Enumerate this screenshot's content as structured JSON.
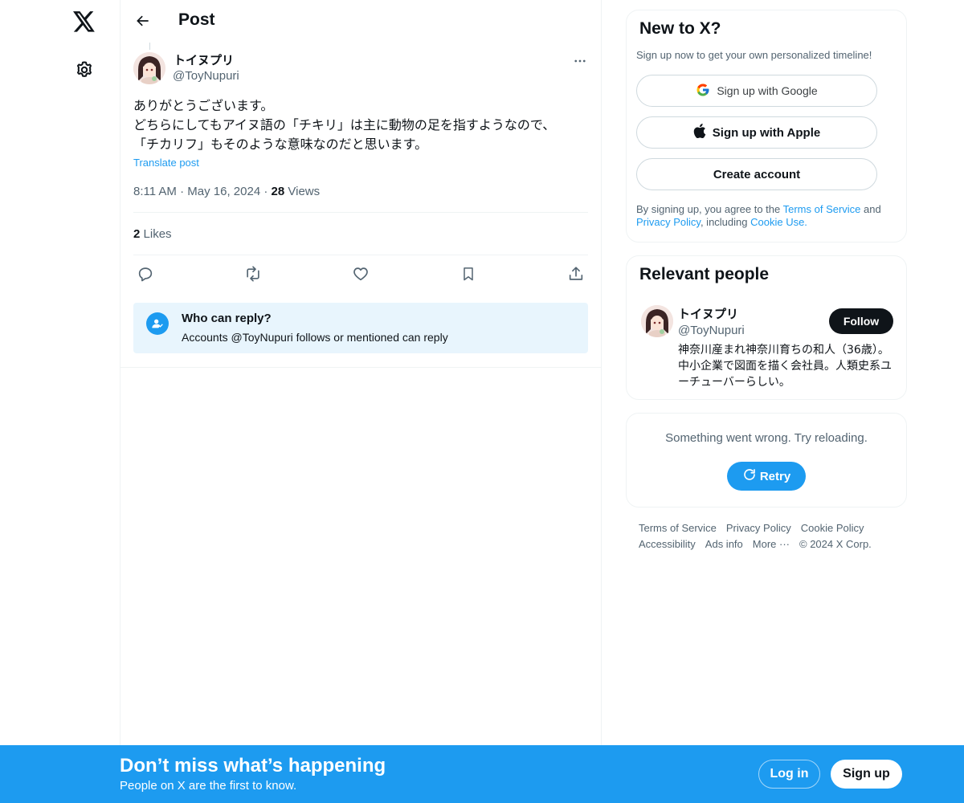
{
  "nav": {
    "logo_icon": "x-logo-icon",
    "settings_icon": "gear-icon"
  },
  "header": {
    "title": "Post"
  },
  "post": {
    "author_name": "トイヌプリ",
    "author_handle": "@ToyNupuri",
    "body_lines": [
      "ありがとうございます。",
      "どちらにしてもアイヌ語の「チキリ」は主に動物の足を指すようなので、",
      "「チカリフ」もそのような意味なのだと思います。"
    ],
    "translate_label": "Translate post",
    "time": "8:11 AM",
    "date": "May 16, 2024",
    "views_count": "28",
    "views_label": "Views",
    "likes_count": "2",
    "likes_label": "Likes"
  },
  "who_can_reply": {
    "title": "Who can reply?",
    "description": "Accounts @ToyNupuri follows or mentioned can reply"
  },
  "signup_card": {
    "title": "New to X?",
    "subtitle": "Sign up now to get your own personalized timeline!",
    "google_label": "Sign up with Google",
    "apple_label": "Sign up with Apple",
    "create_label": "Create account",
    "terms_prefix": "By signing up, you agree to the ",
    "terms_link": "Terms of Service",
    "terms_and": " and",
    "privacy_link": "Privacy Policy",
    "including": ", including ",
    "cookie_link": "Cookie Use."
  },
  "relevant_people": {
    "title": "Relevant people",
    "name": "トイヌプリ",
    "handle": "@ToyNupuri",
    "follow_label": "Follow",
    "bio": "神奈川産まれ神奈川育ちの和人（36歳）。中小企業で図面を描く会社員。人類史系ユーチューバーらしい。"
  },
  "error_card": {
    "message": "Something went wrong. Try reloading.",
    "retry_label": "Retry"
  },
  "footer": {
    "terms": "Terms of Service",
    "privacy": "Privacy Policy",
    "cookie": "Cookie Policy",
    "accessibility": "Accessibility",
    "ads": "Ads info",
    "more": "More ···",
    "copyright": "© 2024 X Corp."
  },
  "banner": {
    "title": "Don’t miss what’s happening",
    "subtitle": "People on X are the first to know.",
    "login_label": "Log in",
    "signup_label": "Sign up"
  },
  "colors": {
    "accent": "#1d9bf0",
    "text": "#0f1419",
    "secondary": "#536471",
    "border": "#eff3f4"
  }
}
